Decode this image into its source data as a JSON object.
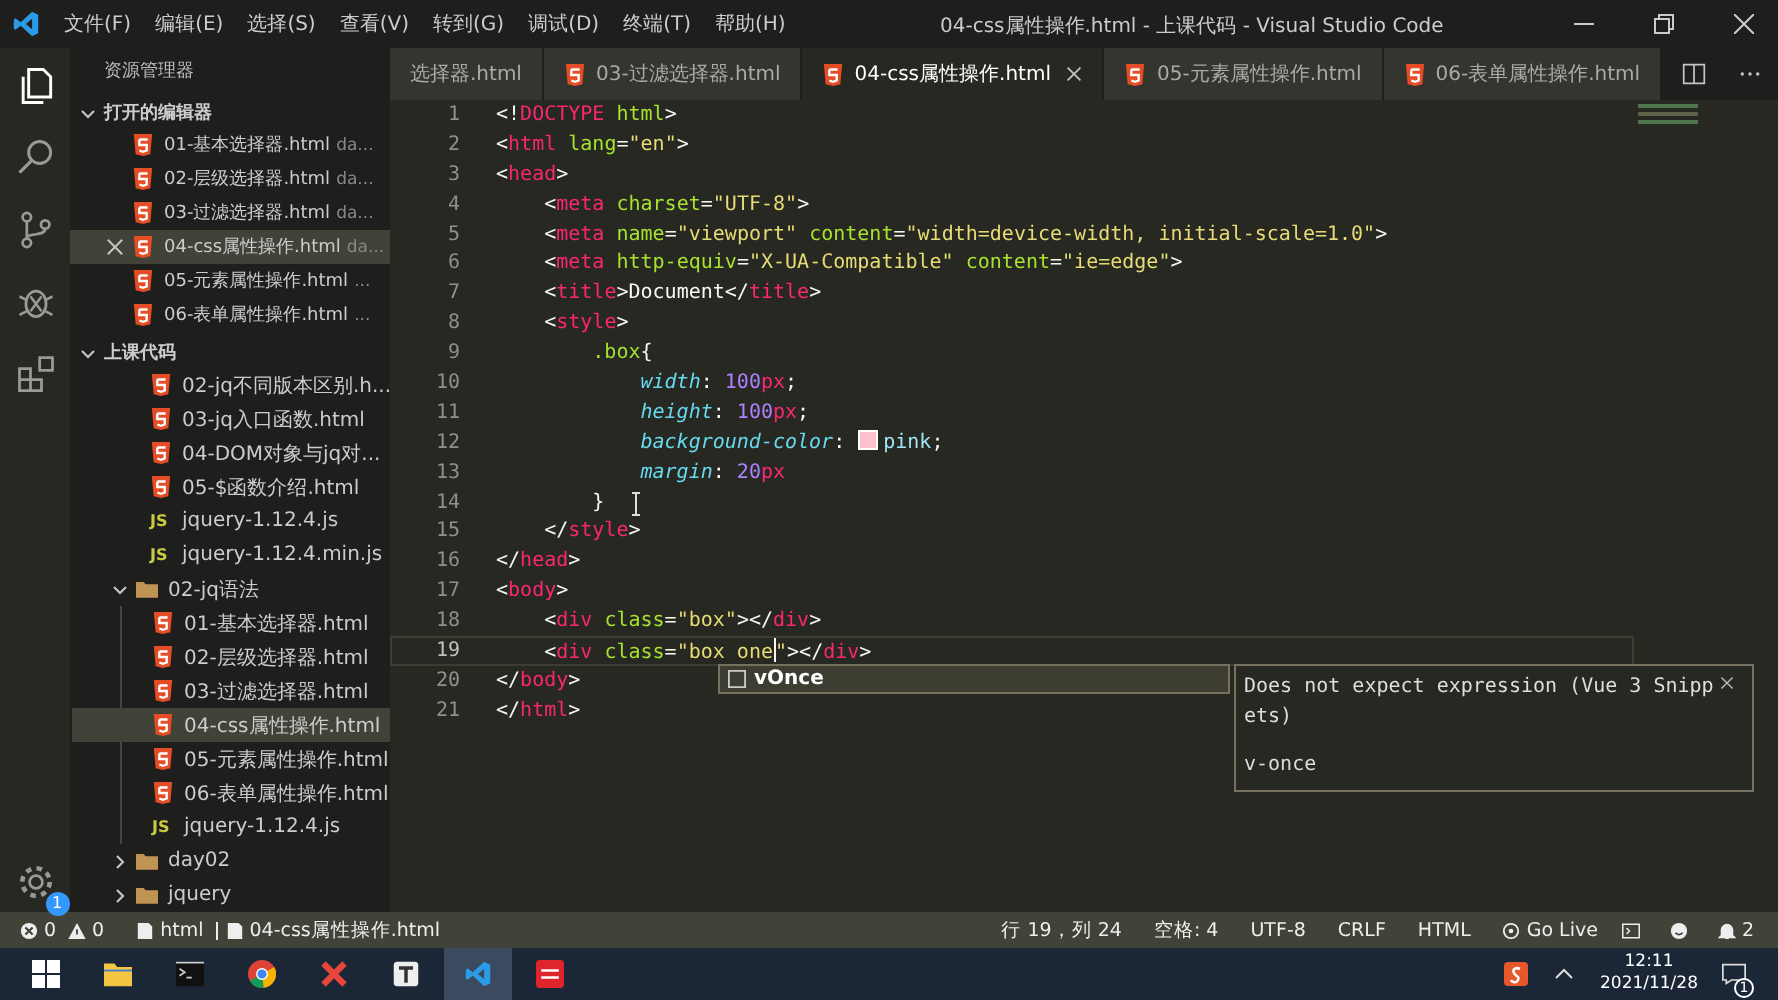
{
  "window": {
    "title": "04-css属性操作.html - 上课代码 - Visual Studio Code"
  },
  "menu": [
    "文件(F)",
    "编辑(E)",
    "选择(S)",
    "查看(V)",
    "转到(G)",
    "调试(D)",
    "终端(T)",
    "帮助(H)"
  ],
  "activity_bar": {
    "settings_badge": "1"
  },
  "sidebar": {
    "title": "资源管理器",
    "open_editors": {
      "title": "打开的编辑器",
      "expanded": true,
      "items": [
        {
          "name": "01-基本选择器.html",
          "description": "da...",
          "selected": false
        },
        {
          "name": "02-层级选择器.html",
          "description": "da...",
          "selected": false
        },
        {
          "name": "03-过滤选择器.html",
          "description": "da...",
          "selected": false
        },
        {
          "name": "04-css属性操作.html",
          "description": "da...",
          "selected": true
        },
        {
          "name": "05-元素属性操作.html",
          "description": "...",
          "selected": false
        },
        {
          "name": "06-表单属性操作.html",
          "description": "...",
          "selected": false
        }
      ]
    },
    "project": {
      "title": "上课代码",
      "expanded": true,
      "items": [
        {
          "kind": "html",
          "name": "02-jq不同版本区别.h...",
          "selected": false
        },
        {
          "kind": "html",
          "name": "03-jq入口函数.html",
          "selected": false
        },
        {
          "kind": "html",
          "name": "04-DOM对象与jq对...",
          "selected": false
        },
        {
          "kind": "html",
          "name": "05-$函数介绍.html",
          "selected": false
        },
        {
          "kind": "js",
          "icon_label": "JS",
          "name": "jquery-1.12.4.js",
          "selected": false
        },
        {
          "kind": "js",
          "icon_label": "JS",
          "name": "jquery-1.12.4.min.js",
          "selected": false
        },
        {
          "kind": "folder",
          "name": "02-jq语法",
          "expanded": true,
          "selected": false,
          "children": [
            {
              "kind": "html",
              "name": "01-基本选择器.html",
              "selected": false
            },
            {
              "kind": "html",
              "name": "02-层级选择器.html",
              "selected": false
            },
            {
              "kind": "html",
              "name": "03-过滤选择器.html",
              "selected": false
            },
            {
              "kind": "html",
              "name": "04-css属性操作.html",
              "selected": true
            },
            {
              "kind": "html",
              "name": "05-元素属性操作.html",
              "selected": false
            },
            {
              "kind": "html",
              "name": "06-表单属性操作.html",
              "selected": false
            },
            {
              "kind": "js",
              "icon_label": "JS",
              "name": "jquery-1.12.4.js",
              "selected": false
            }
          ]
        },
        {
          "kind": "folder",
          "name": "day02",
          "expanded": false,
          "selected": false
        },
        {
          "kind": "folder",
          "name": "jquery",
          "expanded": false,
          "selected": false
        }
      ]
    }
  },
  "tabs": [
    {
      "label": "选择器.html",
      "icon": false,
      "selected": false
    },
    {
      "label": "03-过滤选择器.html",
      "icon": true,
      "selected": false
    },
    {
      "label": "04-css属性操作.html",
      "icon": true,
      "selected": true
    },
    {
      "label": "05-元素属性操作.html",
      "icon": true,
      "selected": false
    },
    {
      "label": "06-表单属性操作.html",
      "icon": true,
      "selected": false
    }
  ],
  "editor": {
    "lines": [
      {
        "number": "1",
        "current": false,
        "tokens": [
          {
            "kind": "p",
            "text": "<!"
          },
          {
            "kind": "tag",
            "text": "DOCTYPE"
          },
          {
            "kind": "attr",
            "text": " html"
          },
          {
            "kind": "p",
            "text": ">"
          }
        ]
      },
      {
        "number": "2",
        "current": false,
        "tokens": [
          {
            "kind": "p",
            "text": "<"
          },
          {
            "kind": "tag",
            "text": "html"
          },
          {
            "kind": "attr",
            "text": " lang"
          },
          {
            "kind": "p",
            "text": "="
          },
          {
            "kind": "str",
            "text": "\"en\""
          },
          {
            "kind": "p",
            "text": ">"
          }
        ]
      },
      {
        "number": "3",
        "current": false,
        "tokens": [
          {
            "kind": "p",
            "text": "<"
          },
          {
            "kind": "tag",
            "text": "head"
          },
          {
            "kind": "p",
            "text": ">"
          }
        ]
      },
      {
        "number": "4",
        "current": false,
        "tokens": [
          {
            "kind": "p",
            "text": "    <"
          },
          {
            "kind": "tag",
            "text": "meta"
          },
          {
            "kind": "attr",
            "text": " charset"
          },
          {
            "kind": "p",
            "text": "="
          },
          {
            "kind": "str",
            "text": "\"UTF-8\""
          },
          {
            "kind": "p",
            "text": ">"
          }
        ]
      },
      {
        "number": "5",
        "current": false,
        "tokens": [
          {
            "kind": "p",
            "text": "    <"
          },
          {
            "kind": "tag",
            "text": "meta"
          },
          {
            "kind": "attr",
            "text": " name"
          },
          {
            "kind": "p",
            "text": "="
          },
          {
            "kind": "str",
            "text": "\"viewport\""
          },
          {
            "kind": "attr",
            "text": " content"
          },
          {
            "kind": "p",
            "text": "="
          },
          {
            "kind": "str",
            "text": "\"width=device-width, initial-scale=1.0\""
          },
          {
            "kind": "p",
            "text": ">"
          }
        ]
      },
      {
        "number": "6",
        "current": false,
        "tokens": [
          {
            "kind": "p",
            "text": "    <"
          },
          {
            "kind": "tag",
            "text": "meta"
          },
          {
            "kind": "attr",
            "text": " http-equiv"
          },
          {
            "kind": "p",
            "text": "="
          },
          {
            "kind": "str",
            "text": "\"X-UA-Compatible\""
          },
          {
            "kind": "attr",
            "text": " content"
          },
          {
            "kind": "p",
            "text": "="
          },
          {
            "kind": "str",
            "text": "\"ie=edge\""
          },
          {
            "kind": "p",
            "text": ">"
          }
        ]
      },
      {
        "number": "7",
        "current": false,
        "tokens": [
          {
            "kind": "p",
            "text": "    <"
          },
          {
            "kind": "tag",
            "text": "title"
          },
          {
            "kind": "p",
            "text": ">Document</"
          },
          {
            "kind": "tag",
            "text": "title"
          },
          {
            "kind": "p",
            "text": ">"
          }
        ]
      },
      {
        "number": "8",
        "current": false,
        "tokens": [
          {
            "kind": "p",
            "text": "    <"
          },
          {
            "kind": "tag",
            "text": "style"
          },
          {
            "kind": "p",
            "text": ">"
          }
        ]
      },
      {
        "number": "9",
        "current": false,
        "tokens": [
          {
            "kind": "sel",
            "text": "        .box"
          },
          {
            "kind": "p",
            "text": "{"
          }
        ]
      },
      {
        "number": "10",
        "current": false,
        "tokens": [
          {
            "kind": "prop",
            "text": "            width"
          },
          {
            "kind": "p",
            "text": ": "
          },
          {
            "kind": "num",
            "text": "100"
          },
          {
            "kind": "unit",
            "text": "px"
          },
          {
            "kind": "p",
            "text": ";"
          }
        ]
      },
      {
        "number": "11",
        "current": false,
        "tokens": [
          {
            "kind": "prop",
            "text": "            height"
          },
          {
            "kind": "p",
            "text": ": "
          },
          {
            "kind": "num",
            "text": "100"
          },
          {
            "kind": "unit",
            "text": "px"
          },
          {
            "kind": "p",
            "text": ";"
          }
        ]
      },
      {
        "number": "12",
        "current": false,
        "tokens": [
          {
            "kind": "prop",
            "text": "            background-color"
          },
          {
            "kind": "p",
            "text": ": "
          },
          {
            "kind": "swatch",
            "color": "#ffc0cb"
          },
          {
            "kind": "kw",
            "text": "pink"
          },
          {
            "kind": "p",
            "text": ";"
          }
        ]
      },
      {
        "number": "13",
        "current": false,
        "tokens": [
          {
            "kind": "prop",
            "text": "            margin"
          },
          {
            "kind": "p",
            "text": ": "
          },
          {
            "kind": "num",
            "text": "20"
          },
          {
            "kind": "unit",
            "text": "px"
          }
        ]
      },
      {
        "number": "14",
        "current": false,
        "tokens": [
          {
            "kind": "p",
            "text": "        }"
          }
        ]
      },
      {
        "number": "15",
        "current": false,
        "tokens": [
          {
            "kind": "p",
            "text": "    </"
          },
          {
            "kind": "tag",
            "text": "style"
          },
          {
            "kind": "p",
            "text": ">"
          }
        ]
      },
      {
        "number": "16",
        "current": false,
        "tokens": [
          {
            "kind": "p",
            "text": "</"
          },
          {
            "kind": "tag",
            "text": "head"
          },
          {
            "kind": "p",
            "text": ">"
          }
        ]
      },
      {
        "number": "17",
        "current": false,
        "tokens": [
          {
            "kind": "p",
            "text": "<"
          },
          {
            "kind": "tag",
            "text": "body"
          },
          {
            "kind": "p",
            "text": ">"
          }
        ]
      },
      {
        "number": "18",
        "current": false,
        "tokens": [
          {
            "kind": "p",
            "text": "    <"
          },
          {
            "kind": "tag",
            "text": "div"
          },
          {
            "kind": "attr",
            "text": " class"
          },
          {
            "kind": "p",
            "text": "="
          },
          {
            "kind": "str",
            "text": "\"box\""
          },
          {
            "kind": "p",
            "text": "></"
          },
          {
            "kind": "tag",
            "text": "div"
          },
          {
            "kind": "p",
            "text": ">"
          }
        ]
      },
      {
        "number": "19",
        "current": true,
        "tokens": [
          {
            "kind": "p",
            "text": "    <"
          },
          {
            "kind": "tag",
            "text": "div"
          },
          {
            "kind": "attr",
            "text": " class"
          },
          {
            "kind": "p",
            "text": "="
          },
          {
            "kind": "str",
            "text": "\"box one"
          },
          {
            "kind": "caret"
          },
          {
            "kind": "str",
            "text": "\""
          },
          {
            "kind": "p",
            "text": "></"
          },
          {
            "kind": "tag",
            "text": "div"
          },
          {
            "kind": "p",
            "text": ">"
          }
        ]
      },
      {
        "number": "20",
        "current": false,
        "tokens": [
          {
            "kind": "p",
            "text": "</"
          },
          {
            "kind": "tag",
            "text": "body"
          },
          {
            "kind": "p",
            "text": ">"
          }
        ]
      },
      {
        "number": "21",
        "current": false,
        "tokens": [
          {
            "kind": "p",
            "text": "</"
          },
          {
            "kind": "tag",
            "text": "html"
          },
          {
            "kind": "p",
            "text": ">"
          }
        ]
      }
    ],
    "suggestion": {
      "label": "vOnce"
    },
    "hover_doc": {
      "text": "Does not expect expression (Vue 3 Snippets)",
      "code": "v-once"
    }
  },
  "status_bar": {
    "errors": "0",
    "warnings": "0",
    "language_id": "html",
    "file": "04-css属性操作.html",
    "position": "行 19，列 24",
    "indent": "空格: 4",
    "encoding": "UTF-8",
    "eol": "CRLF",
    "language": "HTML",
    "live": "Go Live",
    "notifications": "2"
  },
  "taskbar": {
    "time": "12:11",
    "date": "2021/11/28",
    "notification_badge": "1"
  }
}
